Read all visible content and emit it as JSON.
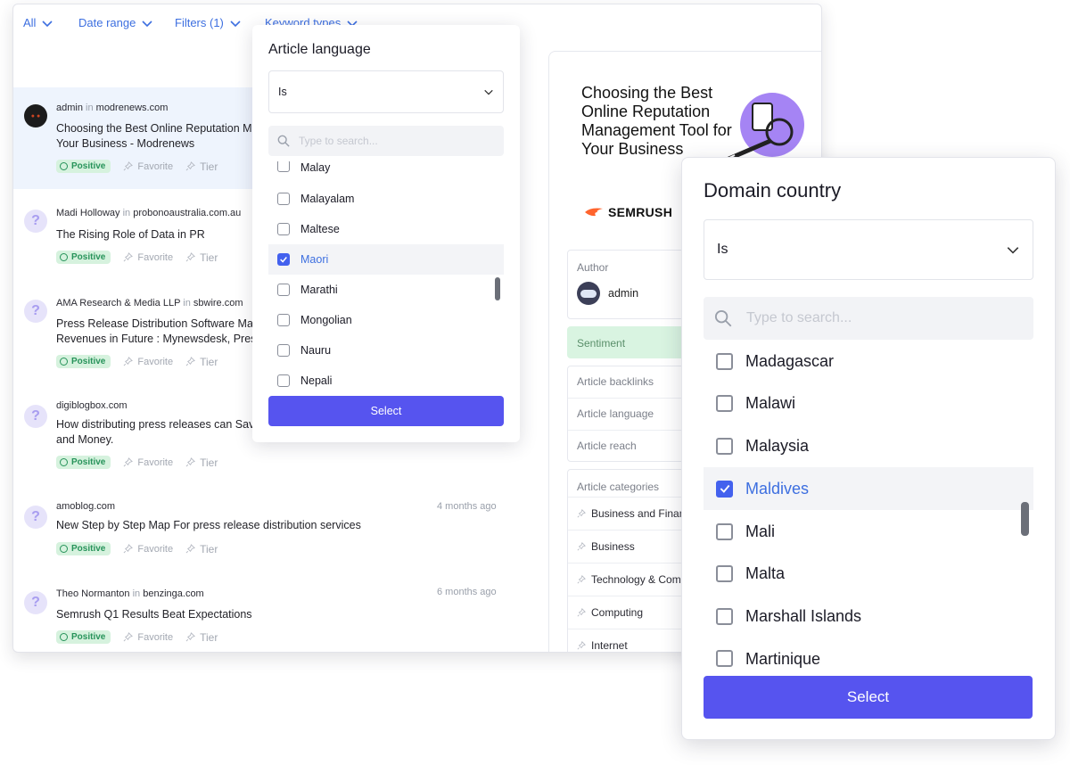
{
  "filters": {
    "tabs": [
      {
        "label": "All"
      },
      {
        "label": "Date range"
      },
      {
        "label": "Filters (1)"
      },
      {
        "label": "Keyword types"
      }
    ]
  },
  "feed": [
    {
      "author": "admin",
      "in": "in",
      "source": "modrenews.com",
      "title_lines": [
        "Choosing the Best Online Reputation Ma",
        "Your Business - Modrenews"
      ],
      "sentiment": "Positive",
      "favorite": "Favorite",
      "tier": "Tier",
      "time": ""
    },
    {
      "author": "Madi Holloway",
      "in": "in",
      "source": "probonoaustralia.com.au",
      "title_lines": [
        "The Rising Role of Data in PR"
      ],
      "sentiment": "Positive",
      "favorite": "Favorite",
      "tier": "Tier",
      "time": ""
    },
    {
      "author": "AMA Research & Media LLP",
      "in": "in",
      "source": "sbwire.com",
      "title_lines": [
        "Press Release Distribution Software Ma",
        "Revenues in Future : Mynewsdesk, Press"
      ],
      "sentiment": "Positive",
      "favorite": "Favorite",
      "tier": "Tier",
      "time": ""
    },
    {
      "author": "",
      "in": "",
      "source": "digiblogbox.com",
      "title_lines": [
        "How distributing press releases can Sav",
        "and Money."
      ],
      "sentiment": "Positive",
      "favorite": "Favorite",
      "tier": "Tier",
      "time": ""
    },
    {
      "author": "",
      "in": "",
      "source": "amoblog.com",
      "title_lines": [
        "New Step by Step Map For press release distribution services"
      ],
      "sentiment": "Positive",
      "favorite": "Favorite",
      "tier": "Tier",
      "time": "4 months ago"
    },
    {
      "author": "Theo Normanton",
      "in": "in",
      "source": "benzinga.com",
      "title_lines": [
        "Semrush Q1 Results Beat Expectations"
      ],
      "sentiment": "Positive",
      "favorite": "Favorite",
      "tier": "Tier",
      "time": "6 months ago"
    }
  ],
  "detail": {
    "hero_title": "Choosing the Best Online Reputation Management Tool for Your Business",
    "brand": "SEMRUSH",
    "author_label": "Author",
    "author_name": "admin",
    "sentiment_label": "Sentiment",
    "fields": [
      "Article backlinks",
      "Article language",
      "Article reach"
    ],
    "categories_label": "Article categories",
    "categories": [
      "Business and Finan",
      "Business",
      "Technology & Com",
      "Computing",
      "Internet"
    ]
  },
  "language_popup": {
    "title": "Article language",
    "operator": "Is",
    "search_placeholder": "Type to search...",
    "options": [
      {
        "label": "Malay",
        "checked": false
      },
      {
        "label": "Malayalam",
        "checked": false
      },
      {
        "label": "Maltese",
        "checked": false
      },
      {
        "label": "Maori",
        "checked": true
      },
      {
        "label": "Marathi",
        "checked": false
      },
      {
        "label": "Mongolian",
        "checked": false
      },
      {
        "label": "Nauru",
        "checked": false
      },
      {
        "label": "Nepali",
        "checked": false
      }
    ],
    "button": "Select"
  },
  "country_popup": {
    "title": "Domain country",
    "operator": "Is",
    "search_placeholder": "Type to search...",
    "options": [
      {
        "label": "Madagascar",
        "checked": false
      },
      {
        "label": "Malawi",
        "checked": false
      },
      {
        "label": "Malaysia",
        "checked": false
      },
      {
        "label": "Maldives",
        "checked": true
      },
      {
        "label": "Mali",
        "checked": false
      },
      {
        "label": "Malta",
        "checked": false
      },
      {
        "label": "Marshall Islands",
        "checked": false
      },
      {
        "label": "Martinique",
        "checked": false
      }
    ],
    "button": "Select"
  },
  "colors": {
    "accent": "#5654ef",
    "link": "#3d6fe0",
    "positive_bg": "#d6f2de",
    "positive_text": "#27935a"
  }
}
